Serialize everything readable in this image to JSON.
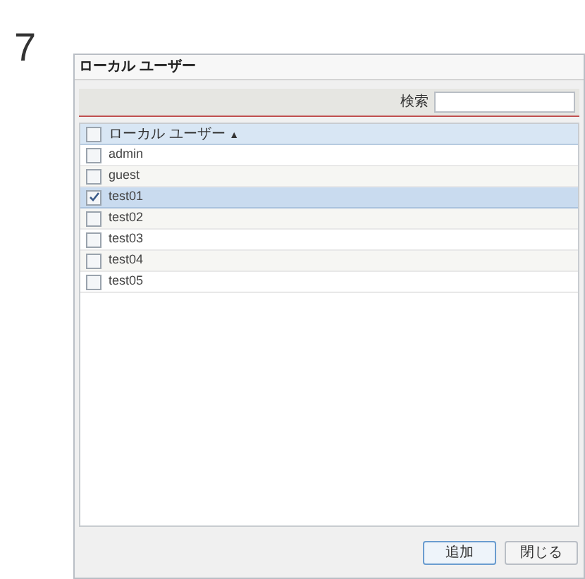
{
  "step": "7",
  "window": {
    "title": "ローカル ユーザー"
  },
  "search": {
    "label": "検索"
  },
  "table": {
    "header": {
      "label": "ローカル ユーザー",
      "sort": "▲",
      "checked": false
    },
    "rows": [
      {
        "name": "admin",
        "checked": false,
        "selected": false
      },
      {
        "name": "guest",
        "checked": false,
        "selected": false
      },
      {
        "name": "test01",
        "checked": true,
        "selected": true
      },
      {
        "name": "test02",
        "checked": false,
        "selected": false
      },
      {
        "name": "test03",
        "checked": false,
        "selected": false
      },
      {
        "name": "test04",
        "checked": false,
        "selected": false
      },
      {
        "name": "test05",
        "checked": false,
        "selected": false
      }
    ]
  },
  "buttons": [
    {
      "label": "追加",
      "kind": "primary"
    },
    {
      "label": "閉じる",
      "kind": "normal"
    }
  ]
}
